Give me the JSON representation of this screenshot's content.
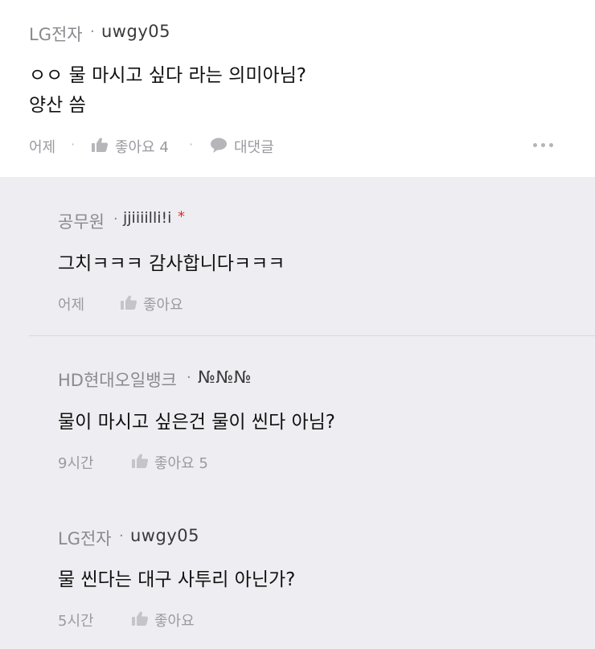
{
  "comment": {
    "company": "LG전자",
    "username": "uwgy05",
    "text_line1": "ㅇㅇ 물 마시고 싶다 라는 의미아님?",
    "text_line2": "양산 씀",
    "time": "어제",
    "like_label": "좋아요 4",
    "reply_label": "대댓글"
  },
  "replies": [
    {
      "company": "공무원",
      "username": "jjiiiilli!i",
      "badge": "*",
      "text": "그치ㅋㅋㅋ 감사합니다ㅋㅋㅋ",
      "time": "어제",
      "like_label": "좋아요"
    },
    {
      "company": "HD현대오일뱅크",
      "username": "№№№",
      "text": "물이 마시고 싶은건 물이 씬다 아님?",
      "time": "9시간",
      "like_label": "좋아요 5"
    },
    {
      "company": "LG전자",
      "username": "uwgy05",
      "text": "물 씬다는 대구 사투리 아닌가?",
      "time": "5시간",
      "like_label": "좋아요"
    }
  ],
  "colors": {
    "reply_background": "#eeeef2",
    "meta_gray": "#9a9aa0",
    "badge_red": "#e8292e"
  }
}
